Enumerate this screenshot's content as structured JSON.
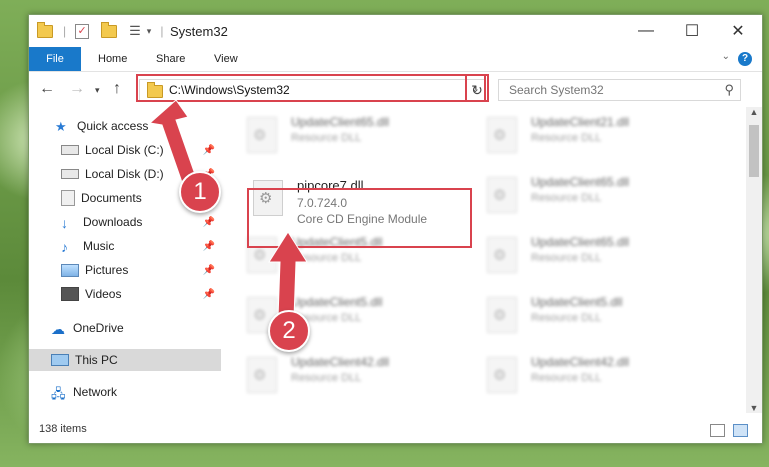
{
  "window": {
    "title": "System32",
    "minimize_symbol": "—",
    "maximize_symbol": "☐",
    "close_symbol": "✕"
  },
  "ribbon": {
    "tabs": [
      "File",
      "Home",
      "Share",
      "View"
    ],
    "help_symbol": "?"
  },
  "address_bar": {
    "path": "C:\\Windows\\System32",
    "dropdown_symbol": "⌄",
    "refresh_symbol": "↻"
  },
  "search": {
    "placeholder": "Search System32"
  },
  "sidebar": {
    "items": [
      {
        "label": "Quick access",
        "icon": "star-icon",
        "pinned": false
      },
      {
        "label": "Local Disk (C:)",
        "icon": "drive-icon",
        "pinned": true
      },
      {
        "label": "Local Disk (D:)",
        "icon": "drive-icon",
        "pinned": true
      },
      {
        "label": "Documents",
        "icon": "documents-icon",
        "pinned": true
      },
      {
        "label": "Downloads",
        "icon": "download-icon",
        "pinned": true
      },
      {
        "label": "Music",
        "icon": "music-icon",
        "pinned": true
      },
      {
        "label": "Pictures",
        "icon": "pictures-icon",
        "pinned": true
      },
      {
        "label": "Videos",
        "icon": "videos-icon",
        "pinned": true
      },
      {
        "label": "OneDrive",
        "icon": "cloud-icon",
        "pinned": false
      },
      {
        "label": "This PC",
        "icon": "computer-icon",
        "pinned": false,
        "selected": true
      },
      {
        "label": "Network",
        "icon": "network-icon",
        "pinned": false
      }
    ]
  },
  "files": {
    "highlighted": {
      "name": "pipcore7.dll",
      "version": "7.0.724.0",
      "description": "Core CD Engine Module"
    },
    "blurred": [
      {
        "name": "UpdateClient65.dll",
        "type": "Resource DLL"
      },
      {
        "name": "UpdateClient21.dll",
        "type": "Resource DLL"
      },
      {
        "name": "UpdateClient65.dll",
        "type": "Resource DLL"
      },
      {
        "name": "UpdateClient5.dll",
        "type": "Resource DLL"
      },
      {
        "name": "UpdateClient65.dll",
        "type": "Resource DLL"
      },
      {
        "name": "UpdateClient5.dll",
        "type": "Resource DLL"
      },
      {
        "name": "UpdateClient5.dll",
        "type": "Resource DLL"
      },
      {
        "name": "UpdateClient42.dll",
        "type": "Resource DLL"
      },
      {
        "name": "UpdateClient42.dll",
        "type": "Resource DLL"
      }
    ]
  },
  "status_bar": {
    "item_count": "138 items"
  },
  "annotations": {
    "step1": "1",
    "step2": "2",
    "accent_color": "#d9434e"
  }
}
